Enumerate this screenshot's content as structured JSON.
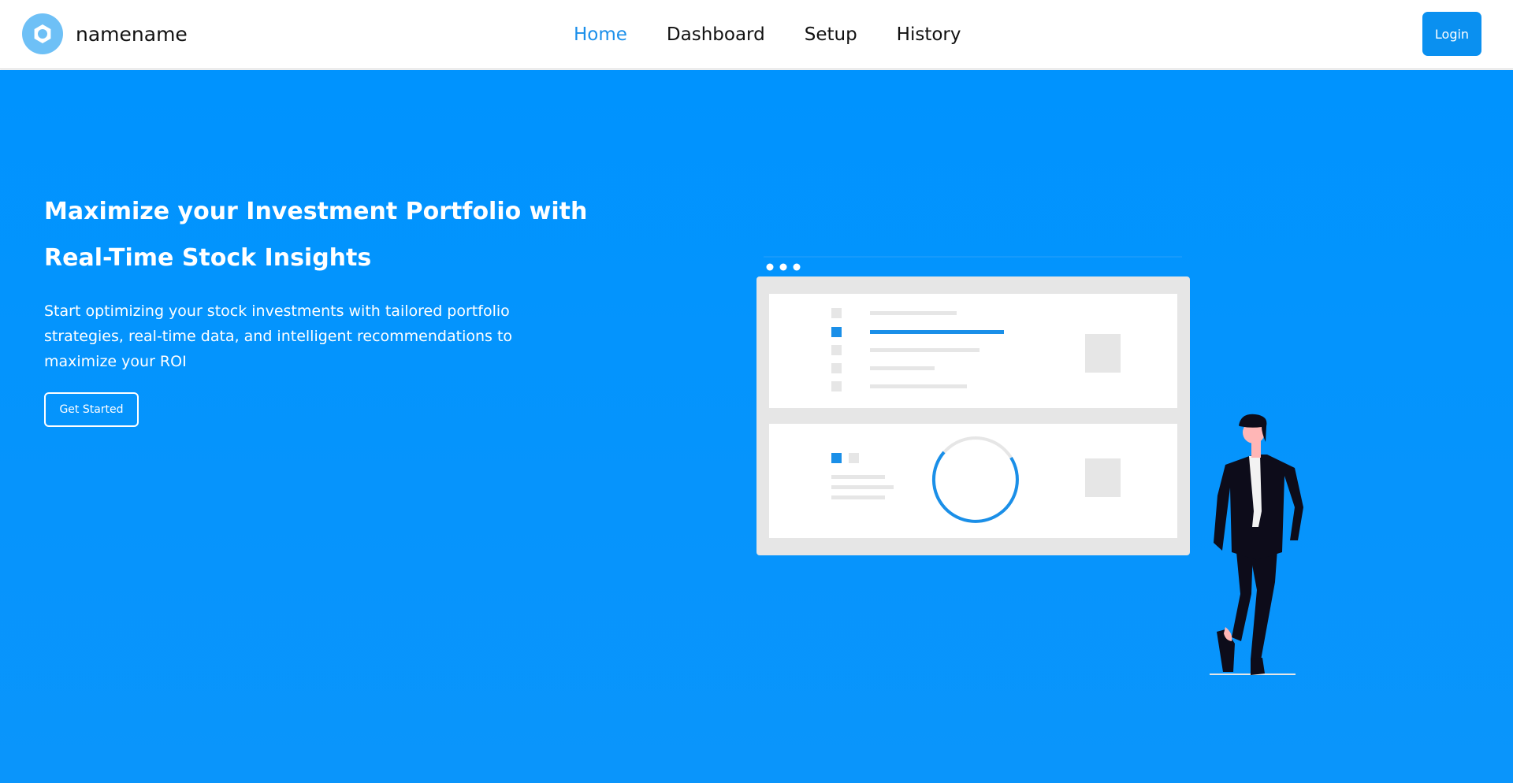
{
  "brand": {
    "name": "namename",
    "logo_icon": "hexagon-ring-icon"
  },
  "nav": {
    "items": [
      {
        "label": "Home",
        "active": true
      },
      {
        "label": "Dashboard",
        "active": false
      },
      {
        "label": "Setup",
        "active": false
      },
      {
        "label": "History",
        "active": false
      }
    ]
  },
  "header": {
    "login_label": "Login"
  },
  "hero": {
    "title": "Maximize your Investment Portfolio with Real-Time Stock Insights",
    "description": "Start optimizing your stock investments with tailored portfolio strategies, real-time data, and intelligent recommendations to maximize your ROI",
    "cta_label": "Get Started"
  },
  "colors": {
    "accent": "#0a90f0",
    "hero_background": "#0093fe",
    "nav_active": "#1b8fea",
    "panel_gray": "#e6e6e6"
  }
}
